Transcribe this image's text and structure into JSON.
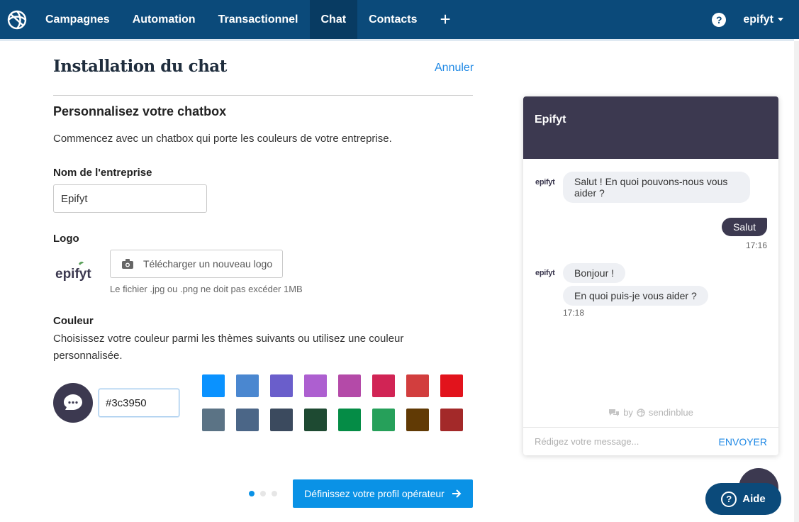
{
  "nav": {
    "items": [
      {
        "label": "Campagnes",
        "active": false
      },
      {
        "label": "Automation",
        "active": false
      },
      {
        "label": "Transactionnel",
        "active": false
      },
      {
        "label": "Chat",
        "active": true
      },
      {
        "label": "Contacts",
        "active": false
      }
    ],
    "plus": "+",
    "help": "?",
    "user": "epifyt"
  },
  "page": {
    "title": "Installation du chat",
    "cancel": "Annuler",
    "section_title": "Personnalisez votre chatbox",
    "section_desc": "Commencez avec un chatbox qui porte les couleurs de votre entreprise."
  },
  "company": {
    "label": "Nom de l'entreprise",
    "value": "Epifyt"
  },
  "logo": {
    "label": "Logo",
    "brand": "epifyt",
    "upload_label": "Télécharger un nouveau logo",
    "hint": "Le fichier .jpg ou .png ne doit pas excéder 1MB"
  },
  "color": {
    "label": "Couleur",
    "desc": "Choisissez votre couleur parmi les thèmes suivants ou utilisez une couleur personnalisée.",
    "hex": "#3c3950",
    "selected": "#3c3950",
    "swatches": [
      "#0a92ff",
      "#4a87d0",
      "#6a5ecb",
      "#ad5fd0",
      "#b44aa8",
      "#d12455",
      "#d23e3e",
      "#e2131c",
      "#5b7385",
      "#4b6687",
      "#3b4a5e",
      "#1e4a32",
      "#058c46",
      "#26a05a",
      "#613a05",
      "#a32929"
    ]
  },
  "pager": {
    "count": 3,
    "active": 0
  },
  "next_button": "Définissez votre profil opérateur",
  "chat": {
    "header": "Epifyt",
    "mini_logo": "epifyt",
    "msg1": "Salut ! En quoi pouvons-nous vous aider ?",
    "reply": "Salut",
    "reply_time": "17:16",
    "msg2": "Bonjour !",
    "msg3": "En quoi puis-je vous aider ?",
    "msg_time": "17:18",
    "powered_by": "by",
    "brand": "sendinblue",
    "placeholder": "Rédigez votre message...",
    "send": "ENVOYER"
  },
  "help_button": "Aide"
}
